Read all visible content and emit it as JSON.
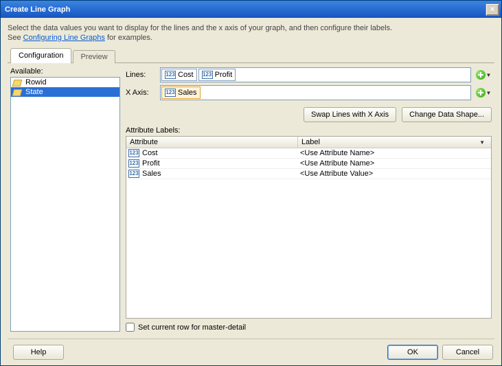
{
  "window": {
    "title": "Create Line Graph",
    "close_symbol": "×"
  },
  "intro": {
    "line1": "Select the data values you want to display for the lines and the x axis of your graph, and then configure their labels.",
    "line2a": "See ",
    "link": "Configuring Line Graphs",
    "line2b": " for examples."
  },
  "tabs": {
    "configuration": "Configuration",
    "preview": "Preview"
  },
  "available": {
    "label": "Available:",
    "items": [
      {
        "name": "Rowid",
        "selected": false
      },
      {
        "name": "State",
        "selected": true
      }
    ]
  },
  "fields": {
    "lines_label": "Lines:",
    "xaxis_label": "X Axis:",
    "lines_values": [
      "Cost",
      "Profit"
    ],
    "xaxis_values": [
      "Sales"
    ],
    "num_icon_text": "123"
  },
  "actions": {
    "swap": "Swap Lines with X Axis",
    "change_shape": "Change Data Shape..."
  },
  "attributes": {
    "section_label": "Attribute Labels:",
    "header_attr": "Attribute",
    "header_label": "Label",
    "rows": [
      {
        "attr": "Cost",
        "label": "<Use Attribute Name>"
      },
      {
        "attr": "Profit",
        "label": "<Use Attribute Name>"
      },
      {
        "attr": "Sales",
        "label": "<Use Attribute Value>"
      }
    ]
  },
  "checkbox": {
    "label": "Set current row for master-detail"
  },
  "footer": {
    "help": "Help",
    "ok": "OK",
    "cancel": "Cancel"
  }
}
